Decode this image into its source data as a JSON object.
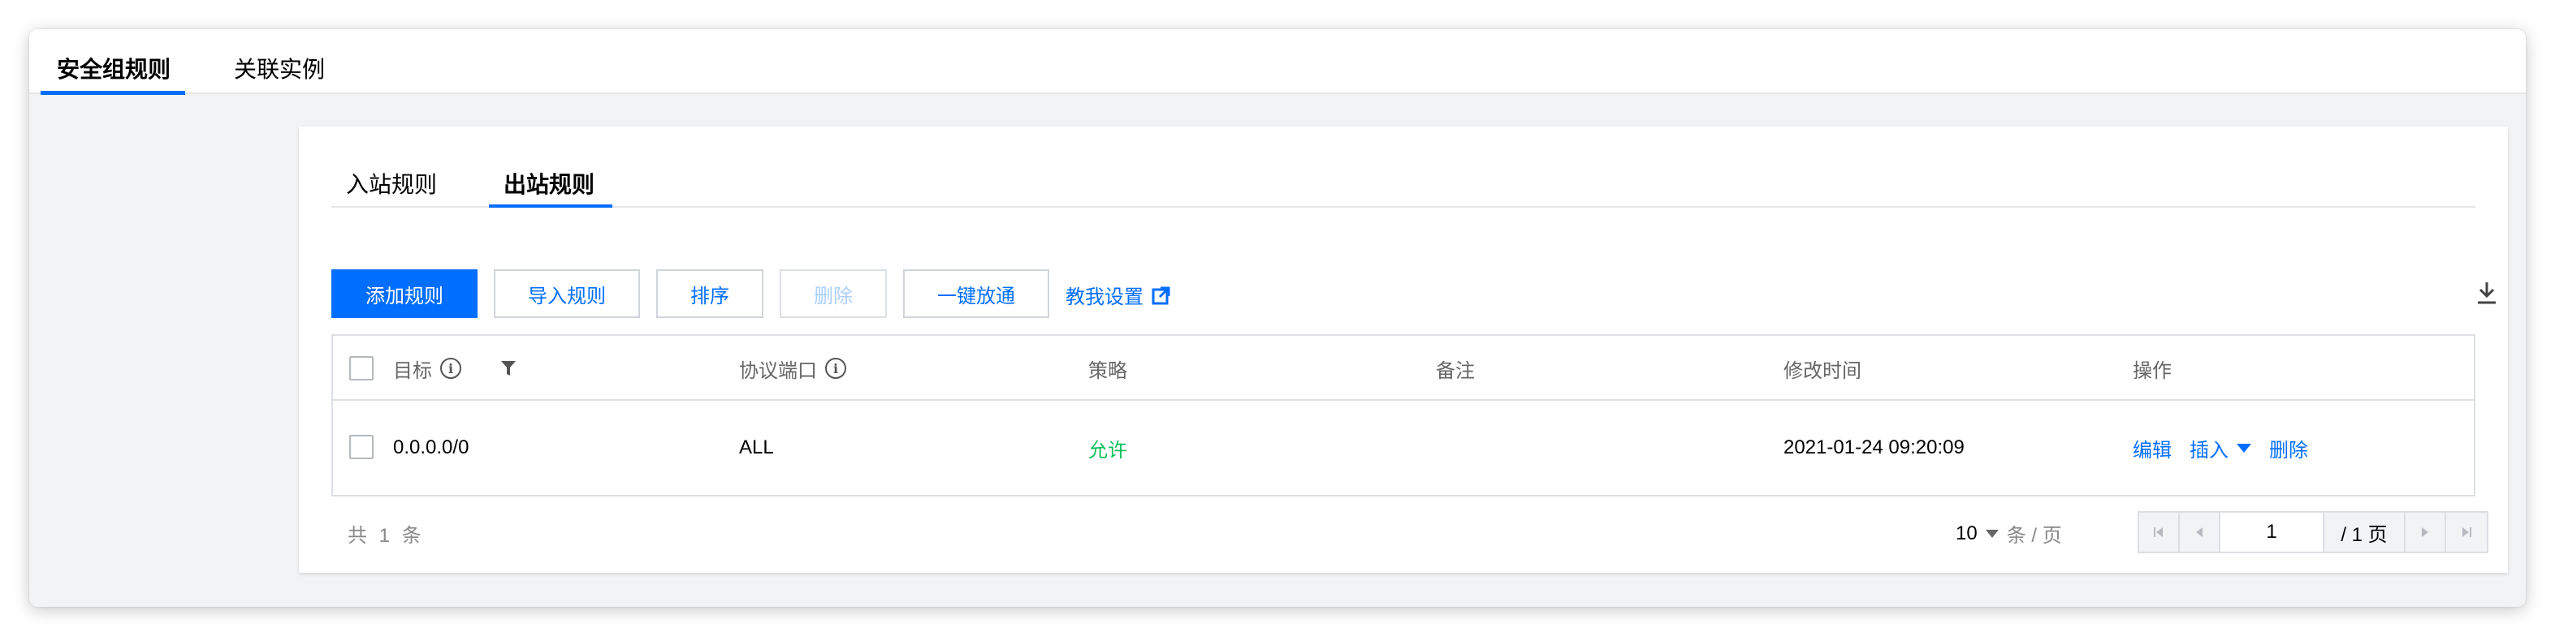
{
  "top_tabs": [
    {
      "label": "安全组规则",
      "active": true
    },
    {
      "label": "关联实例",
      "active": false
    }
  ],
  "sub_tabs": [
    {
      "label": "入站规则",
      "active": false
    },
    {
      "label": "出站规则",
      "active": true
    }
  ],
  "toolbar": {
    "add_rule": "添加规则",
    "import_rule": "导入规则",
    "sort": "排序",
    "delete": "删除",
    "one_click_open": "一键放通",
    "teach_me": "教我设置"
  },
  "table": {
    "columns": [
      "目标",
      "协议端口",
      "策略",
      "备注",
      "修改时间",
      "操作"
    ],
    "rows": [
      {
        "target": "0.0.0.0/0",
        "protocol_port": "ALL",
        "policy": "允许",
        "remark": "",
        "modified_time": "2021-01-24 09:20:09",
        "actions": {
          "edit": "编辑",
          "insert": "插入",
          "delete": "删除"
        }
      }
    ]
  },
  "footer": {
    "total": "共 1 条",
    "page_size": "10",
    "page_size_unit": "条 / 页",
    "current_page": "1",
    "total_pages": "/ 1 页"
  },
  "colors": {
    "accent": "#006eff",
    "allow": "#0abf5b",
    "disabled": "#aacfff"
  },
  "icons": [
    "info-icon",
    "filter-icon",
    "external-link-icon",
    "download-icon",
    "first-page-icon",
    "prev-page-icon",
    "next-page-icon",
    "last-page-icon"
  ]
}
